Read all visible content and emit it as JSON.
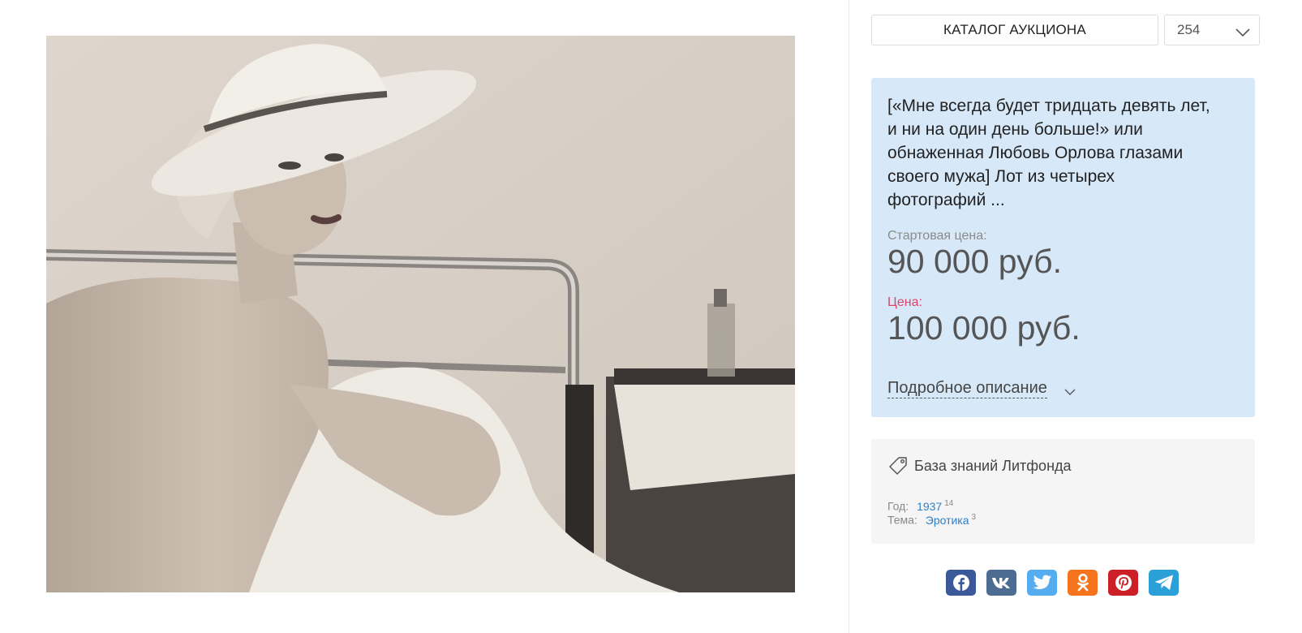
{
  "header": {
    "catalog_button": "КАТАЛОГ АУКЦИОНА",
    "lot_select_value": "254"
  },
  "lot": {
    "title_lines": [
      "[«Мне всегда будет тридцать девять лет,",
      "и ни на один день больше!» или",
      "обнаженная Любовь Орлова глазами",
      "своего мужа] Лот из четырех",
      "фотографий ..."
    ],
    "start_price_label": "Стартовая цена:",
    "start_price": "90 000 руб.",
    "price_label": "Цена:",
    "price": "100 000 руб.",
    "details_link": "Подробное описание"
  },
  "knowledge": {
    "label": "База знаний Литфонда",
    "year_label": "Год:",
    "year_value": "1937",
    "year_count": "14",
    "theme_label": "Тема:",
    "theme_value": "Эротика",
    "theme_count": "3"
  },
  "share": [
    {
      "name": "facebook",
      "icon": "facebook-icon",
      "color": "#3b5998"
    },
    {
      "name": "vk",
      "icon": "vk-icon",
      "color": "#4c6c91"
    },
    {
      "name": "twitter",
      "icon": "twitter-icon",
      "color": "#55acee"
    },
    {
      "name": "odnoklassniki",
      "icon": "odnoklassniki-icon",
      "color": "#f4731c"
    },
    {
      "name": "pinterest",
      "icon": "pinterest-icon",
      "color": "#cb2027"
    },
    {
      "name": "telegram",
      "icon": "telegram-icon",
      "color": "#2b9fd8"
    }
  ],
  "colors": {
    "card_blue": "#d7e9f9",
    "card_grey": "#f5f5f5",
    "price_label_accent": "#e0446a",
    "link_blue": "#2f7fc5"
  }
}
